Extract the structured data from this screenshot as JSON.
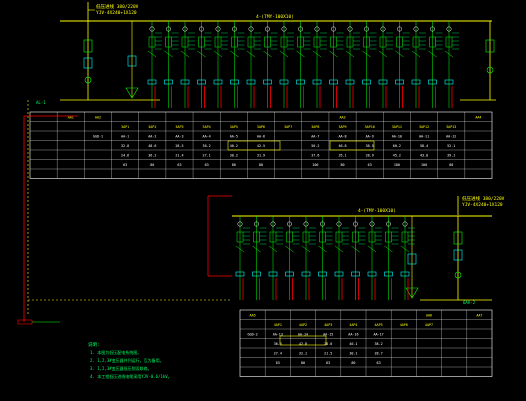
{
  "colors": {
    "background": "#000000",
    "grid_yellow": "#ffff00",
    "table_white": "#ffffff",
    "bus_green": "#00ff00",
    "feeder_red": "#ff0000",
    "breaker_cyan": "#00ffff",
    "label_green": "#00ff66",
    "wire_magenta": "#ff00ff"
  },
  "upper_panel": {
    "incoming_label_1": "低压进线 380/220V",
    "incoming_label_2": "YJV-4X240+1X120",
    "busbar_label": "4-(TMY-100X10)",
    "left_tag": "AL-1",
    "bottom_left_tag": "6AA-1",
    "table": {
      "header_rows": [
        [
          "",
          "AA1",
          "AA2",
          "",
          "",
          "",
          "",
          "",
          "",
          "",
          "",
          "AA3",
          "",
          "",
          "",
          "",
          "AA4"
        ],
        [
          "",
          "",
          "",
          "3AP1",
          "3AP2",
          "3AP3",
          "3AP4",
          "3AP5",
          "3AP6",
          "3AP7",
          "3AP8",
          "3AP9",
          "3AP10",
          "3AP11",
          "3AP12",
          "3AP13",
          ""
        ]
      ],
      "data_rows": [
        [
          "",
          "",
          "GGD-1",
          "AA-1",
          "AA-2",
          "AA-3",
          "AA-4",
          "AA-5",
          "AA-6",
          "",
          "AA-7",
          "AA-8",
          "AA-9",
          "AA-10",
          "AA-11",
          "AA-12",
          ""
        ],
        [
          "",
          "",
          "",
          "32.8",
          "48.6",
          "28.5",
          "36.2",
          "40.2",
          "42.5",
          "",
          "50.2",
          "46.8",
          "38.5",
          "60.2",
          "58.4",
          "52.1",
          ""
        ],
        [
          "",
          "",
          "",
          "24.6",
          "36.2",
          "21.4",
          "27.1",
          "30.2",
          "31.9",
          "",
          "37.6",
          "35.1",
          "28.9",
          "45.2",
          "43.8",
          "39.1",
          ""
        ],
        [
          "",
          "",
          "",
          "63",
          "80",
          "63",
          "63",
          "80",
          "80",
          "",
          "100",
          "80",
          "63",
          "100",
          "100",
          "80",
          ""
        ],
        [
          "",
          "",
          "",
          "",
          "",
          "",
          "",
          "",
          "",
          "",
          "",
          "",
          "",
          "",
          "",
          "",
          ""
        ]
      ]
    }
  },
  "lower_panel": {
    "incoming_label_1": "低压进线 380/220V",
    "incoming_label_2": "YJV-4X240+1X120",
    "busbar_label": "4-(TMY-100X10)",
    "right_tag": "6AA-2",
    "table": {
      "header_rows": [
        [
          "AA5",
          "",
          "",
          "",
          "",
          "",
          "",
          "AA6",
          "",
          "AA7"
        ],
        [
          "",
          "4AP1",
          "4AP2",
          "4AP3",
          "4AP4",
          "4AP5",
          "4AP6",
          "4AP7",
          "",
          ""
        ]
      ],
      "data_rows": [
        [
          "GGD-2",
          "AA-13",
          "AA-14",
          "AA-15",
          "AA-16",
          "AA-17",
          "",
          "",
          "",
          ""
        ],
        [
          "",
          "36.5",
          "42.8",
          "28.6",
          "40.1",
          "38.2",
          "",
          "",
          "",
          ""
        ],
        [
          "",
          "27.4",
          "32.1",
          "21.5",
          "30.1",
          "28.7",
          "",
          "",
          "",
          ""
        ],
        [
          "",
          "63",
          "80",
          "63",
          "80",
          "63",
          "",
          "",
          "",
          ""
        ],
        [
          "",
          "",
          "",
          "",
          "",
          "",
          "",
          "",
          "",
          ""
        ]
      ]
    }
  },
  "notes": {
    "title": "说明:",
    "lines": [
      "1. 本图为低压配电系统图。",
      "2. 1,2,3#变压器并列运行，互为备用。",
      "3. 1,2,3#变压器低压侧设联络。",
      "4. 本工程低压进线电缆采用YJV-0.6/1kV。"
    ]
  }
}
